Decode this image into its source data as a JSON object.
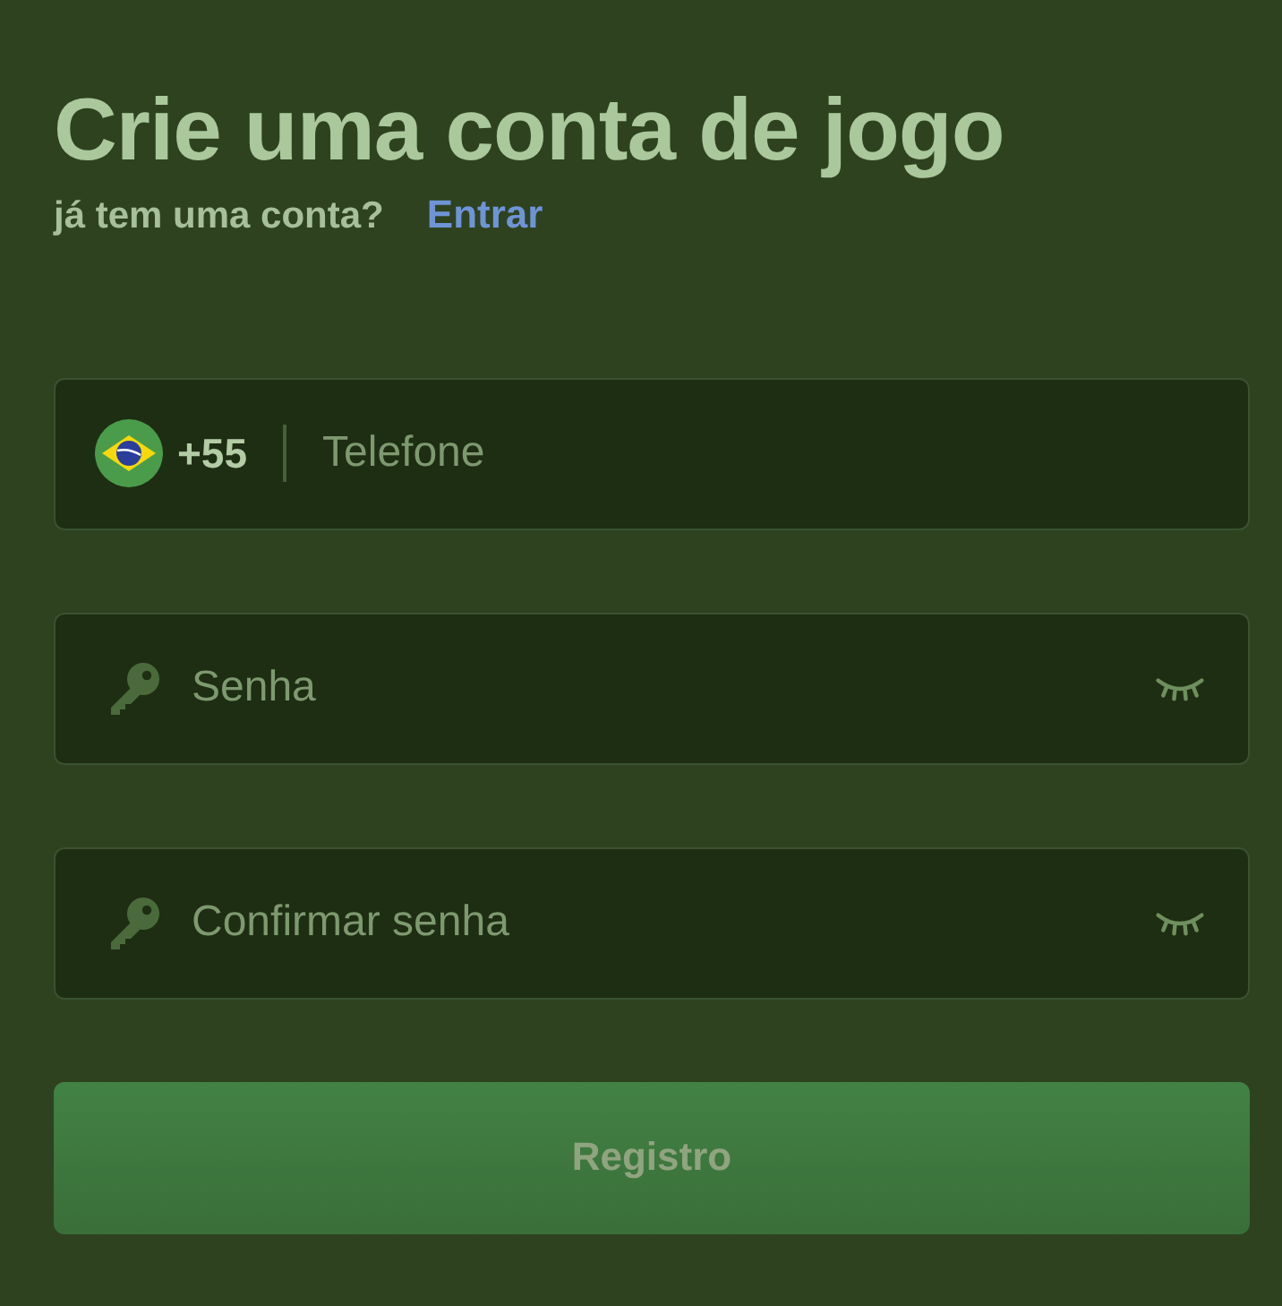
{
  "title": "Crie uma conta de jogo",
  "login_prompt": {
    "text": "já tem uma conta?",
    "link": "Entrar"
  },
  "phone_field": {
    "country_code": "+55",
    "placeholder": "Telefone"
  },
  "password_fields": [
    {
      "placeholder": "Senha",
      "visible": false
    },
    {
      "placeholder": "Confirmar senha",
      "visible": false
    }
  ],
  "submit_button": {
    "label": "Registro",
    "disabled": true
  }
}
